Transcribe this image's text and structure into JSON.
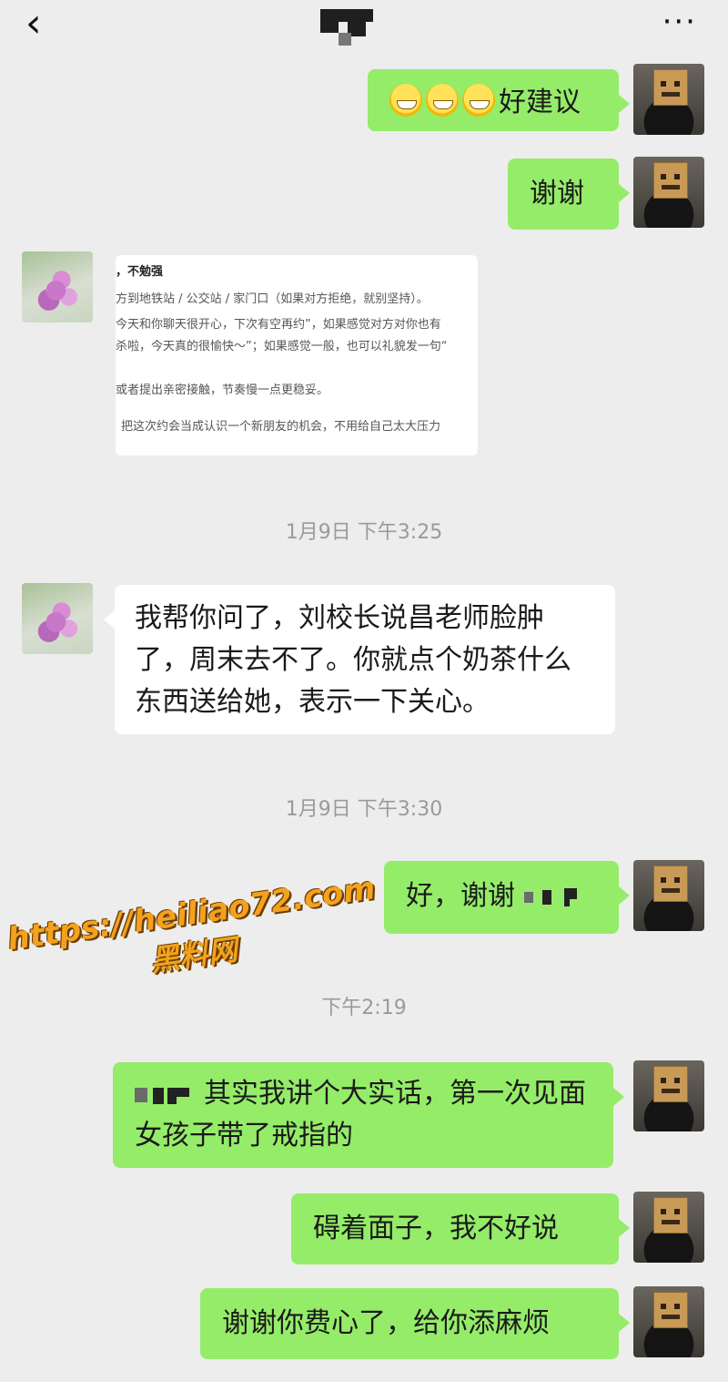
{
  "header": {
    "back_icon": "chevron-left-icon",
    "more_label": "···"
  },
  "messages": {
    "m1": {
      "text": "好建议"
    },
    "m2": {
      "text": "谢谢"
    },
    "doc": {
      "lines": [
        "，不勉强",
        "方到地铁站 / 公交站 / 家门口（如果对方拒绝，就别坚持）。",
        "今天和你聊天很开心，下次有空再约”，如果感觉对方对你也有",
        "杀啦，今天真的很愉快～”；如果感觉一般，也可以礼貌发一句“",
        "或者提出亲密接触，节奏慢一点更稳妥。",
        "把这次约会当成认识一个新朋友的机会，不用给自己太大压力"
      ]
    },
    "t1": "1月9日 下午3:25",
    "m3": {
      "text": "我帮你问了，刘校长说昌老师脸肿了，周末去不了。你就点个奶茶什么东西送给她，表示一下关心。"
    },
    "t2": "1月9日 下午3:30",
    "m4": {
      "text": "好，谢谢"
    },
    "t3": "下午2:19",
    "m5": {
      "text": "其实我讲个大实话，第一次见面女孩子带了戒指的"
    },
    "m6": {
      "text": "碍着面子，我不好说"
    },
    "m7": {
      "text": "谢谢你费心了，给你添麻烦"
    }
  },
  "watermark": {
    "url": "https://heiliao72.com",
    "site": "黑料网"
  },
  "colors": {
    "background": "#ededed",
    "bubble_green": "#95ec69",
    "bubble_white": "#ffffff",
    "timestamp": "#9a9a9a"
  }
}
